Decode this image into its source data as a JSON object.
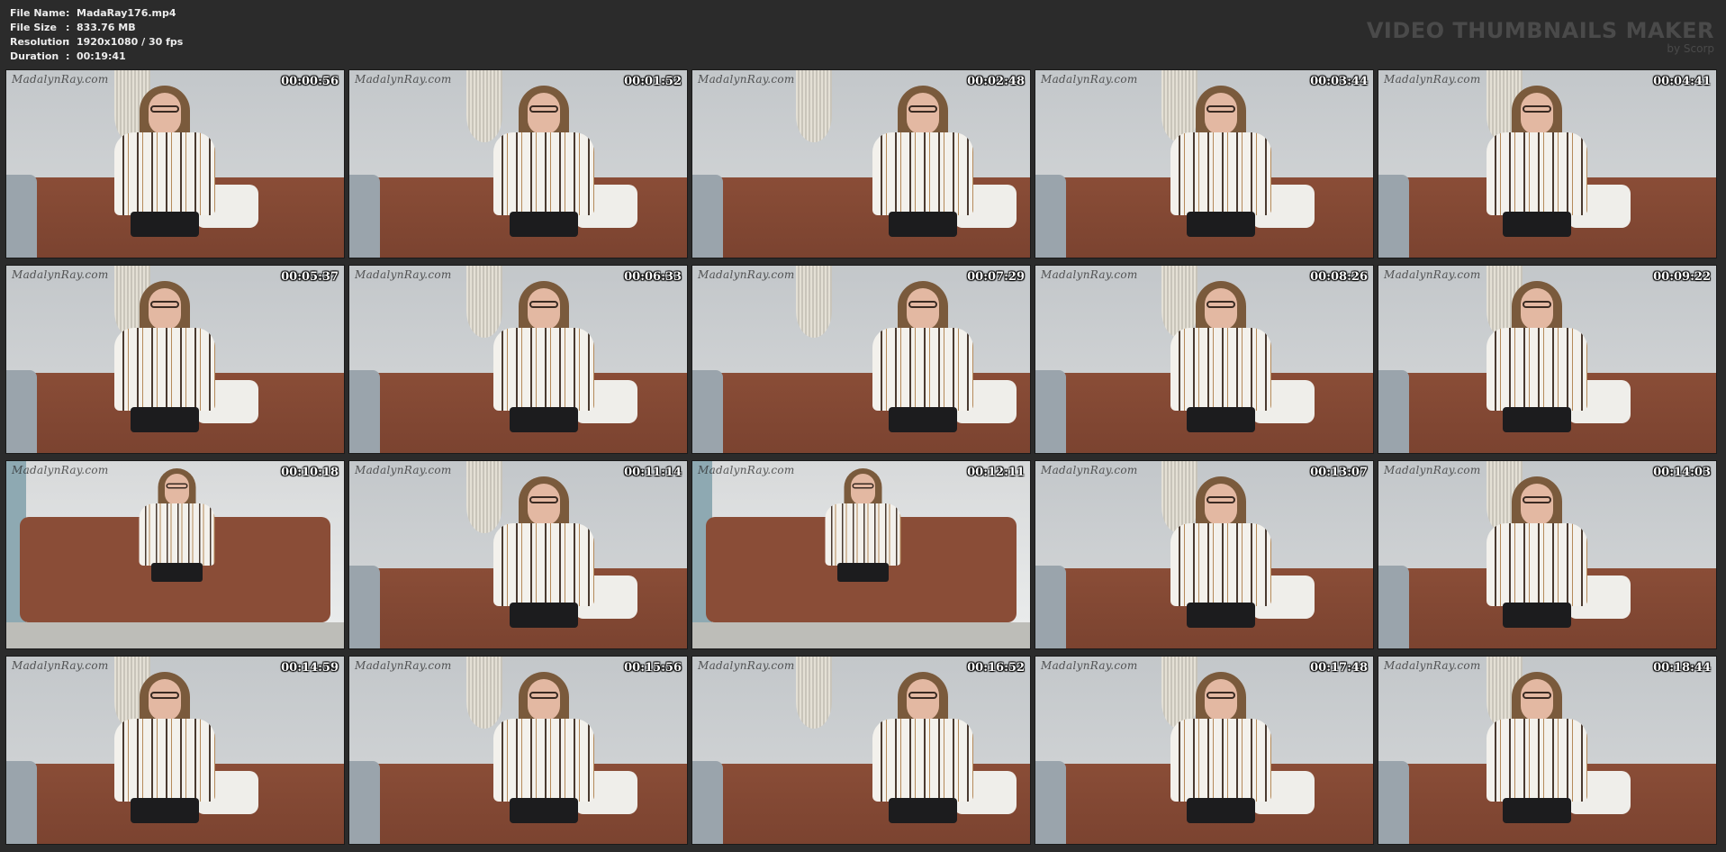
{
  "info": {
    "rows": [
      {
        "key": "File Name",
        "sep": ":",
        "value": "MadaRay176.mp4"
      },
      {
        "key": "File Size",
        "sep": ":",
        "value": "833.76 MB"
      },
      {
        "key": "Resolution",
        "sep": ":",
        "value": "1920x1080 / 30 fps"
      },
      {
        "key": "Duration",
        "sep": ":",
        "value": "00:19:41"
      }
    ]
  },
  "brand": {
    "title": "VIDEO THUMBNAILS MAKER",
    "by": "by Scorp"
  },
  "watermark": "MadalynRay.com",
  "thumbnails": [
    {
      "time": "00:00:56"
    },
    {
      "time": "00:01:52"
    },
    {
      "time": "00:02:48"
    },
    {
      "time": "00:03:44"
    },
    {
      "time": "00:04:41"
    },
    {
      "time": "00:05:37"
    },
    {
      "time": "00:06:33"
    },
    {
      "time": "00:07:29"
    },
    {
      "time": "00:08:26"
    },
    {
      "time": "00:09:22"
    },
    {
      "time": "00:10:18"
    },
    {
      "time": "00:11:14"
    },
    {
      "time": "00:12:11"
    },
    {
      "time": "00:13:07"
    },
    {
      "time": "00:14:03"
    },
    {
      "time": "00:14:59"
    },
    {
      "time": "00:15:56"
    },
    {
      "time": "00:16:52"
    },
    {
      "time": "00:17:48"
    },
    {
      "time": "00:18:44"
    }
  ]
}
